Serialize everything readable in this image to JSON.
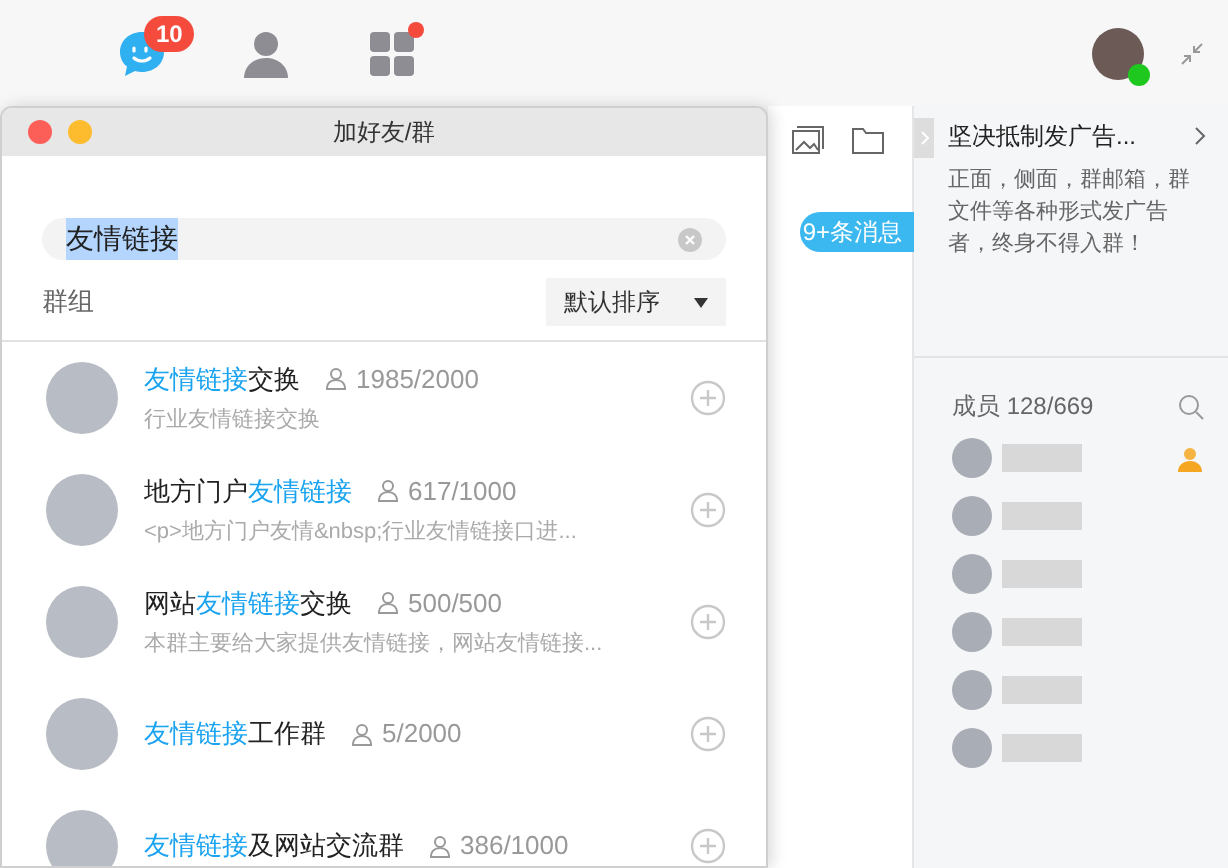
{
  "toolbar": {
    "messages_badge": "10",
    "apps_dot": true
  },
  "dialog": {
    "title": "加好友/群",
    "search": {
      "value": "友情链接",
      "selected": true
    },
    "section_label": "群组",
    "sort": "默认排序",
    "groups": [
      {
        "name_parts": [
          {
            "text": "友情链接",
            "highlight": true
          },
          {
            "text": "交换",
            "highlight": false
          }
        ],
        "count": "1985/2000",
        "desc": "行业友情链接交换"
      },
      {
        "name_parts": [
          {
            "text": "地方门户",
            "highlight": false
          },
          {
            "text": "友情链接",
            "highlight": true
          }
        ],
        "count": "617/1000",
        "desc": "<p>地方门户友情&nbsp;行业友情链接口进..."
      },
      {
        "name_parts": [
          {
            "text": "网站",
            "highlight": false
          },
          {
            "text": "友情链接",
            "highlight": true
          },
          {
            "text": "交换",
            "highlight": false
          }
        ],
        "count": "500/500",
        "desc": "本群主要给大家提供友情链接，网站友情链接..."
      },
      {
        "name_parts": [
          {
            "text": "友情链接",
            "highlight": true
          },
          {
            "text": "工作群",
            "highlight": false
          }
        ],
        "count": "5/2000"
      },
      {
        "name_parts": [
          {
            "text": "友情链接",
            "highlight": true
          },
          {
            "text": "及网站交流群",
            "highlight": false
          }
        ],
        "count": "386/1000"
      }
    ]
  },
  "chat": {
    "unread_pill": "9+条消息"
  },
  "group_panel": {
    "notice_title": "坚决抵制发广告...",
    "notice_body": "正面，侧面，群邮箱，群文件等各种形式发广告者，终身不得入群！",
    "members_label": "成员 128/669",
    "members": [
      {
        "owner": true
      },
      {
        "owner": false
      },
      {
        "owner": false
      },
      {
        "owner": false
      },
      {
        "owner": false
      },
      {
        "owner": false
      }
    ]
  }
}
